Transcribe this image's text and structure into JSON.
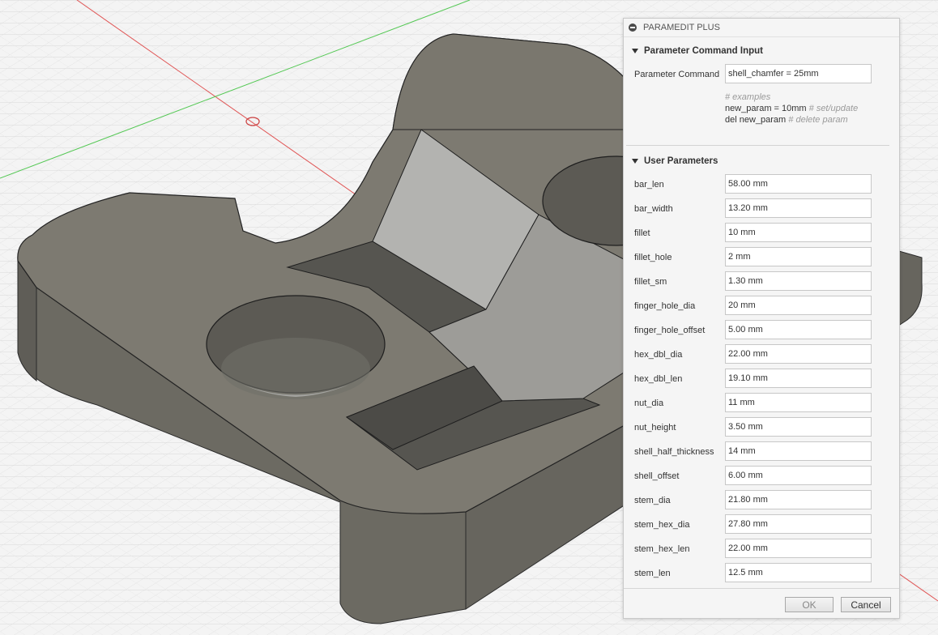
{
  "dialog": {
    "title": "PARAMEDIT PLUS",
    "collapse_icon": "minus-circle-icon",
    "command_section": {
      "header": "Parameter Command Input",
      "label": "Parameter Command",
      "value": "shell_chamfer = 25mm",
      "examples_header": "# examples",
      "example_set": "new_param = 10mm",
      "example_set_note": "# set/update",
      "example_delete": "del new_param",
      "example_delete_note": "# delete param"
    },
    "user_section": {
      "header": "User Parameters",
      "params": [
        {
          "name": "bar_len",
          "value": "58.00 mm"
        },
        {
          "name": "bar_width",
          "value": "13.20 mm"
        },
        {
          "name": "fillet",
          "value": "10 mm"
        },
        {
          "name": "fillet_hole",
          "value": "2 mm"
        },
        {
          "name": "fillet_sm",
          "value": "1.30 mm"
        },
        {
          "name": "finger_hole_dia",
          "value": "20 mm"
        },
        {
          "name": "finger_hole_offset",
          "value": "5.00 mm"
        },
        {
          "name": "hex_dbl_dia",
          "value": "22.00 mm"
        },
        {
          "name": "hex_dbl_len",
          "value": "19.10 mm"
        },
        {
          "name": "nut_dia",
          "value": "11 mm"
        },
        {
          "name": "nut_height",
          "value": "3.50 mm"
        },
        {
          "name": "shell_half_thickness",
          "value": "14 mm"
        },
        {
          "name": "shell_offset",
          "value": "6.00 mm"
        },
        {
          "name": "stem_dia",
          "value": "21.80 mm"
        },
        {
          "name": "stem_hex_dia",
          "value": "27.80 mm"
        },
        {
          "name": "stem_hex_len",
          "value": "22.00 mm"
        },
        {
          "name": "stem_len",
          "value": "12.5 mm"
        }
      ]
    },
    "buttons": {
      "ok": "OK",
      "cancel": "Cancel"
    }
  },
  "viewport": {
    "background": "#f4f4f4",
    "grid_color": "#d9d9d9",
    "model_top_color": "#7d7a71",
    "model_side_color": "#6b6961",
    "x_axis_color": "#e05555",
    "y_axis_color": "#55c855"
  }
}
